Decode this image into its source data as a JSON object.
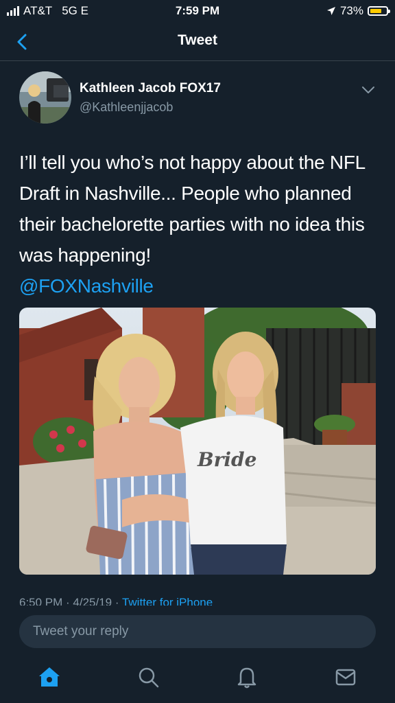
{
  "status_bar": {
    "carrier": "AT&T",
    "network": "5G E",
    "time": "7:59 PM",
    "battery": "73%",
    "battery_level": 0.73,
    "battery_color": "#ffcc00"
  },
  "nav": {
    "title": "Tweet",
    "back_icon": "chevron-left-icon"
  },
  "tweet": {
    "author_name": "Kathleen Jacob FOX17",
    "author_handle": "@Kathleenjjacob",
    "text": "I’ll tell you who’s not happy about the NFL Draft in Nashville... People who planned their bachelorette parties with no idea this was happening!",
    "mention": "@FOXNashville",
    "shirt_text": "Bride",
    "timestamp": "6:50 PM · 4/25/19 · ",
    "source": "Twitter for iPhone"
  },
  "reply": {
    "placeholder": "Tweet your reply"
  },
  "tab_bar": {
    "items": [
      "home-icon",
      "search-icon",
      "notifications-icon",
      "messages-icon"
    ],
    "active_color": "#1da1f2",
    "inactive_color": "#8899a6"
  },
  "colors": {
    "background": "#15202b",
    "accent": "#1da1f2",
    "secondary_text": "#8899a6"
  }
}
